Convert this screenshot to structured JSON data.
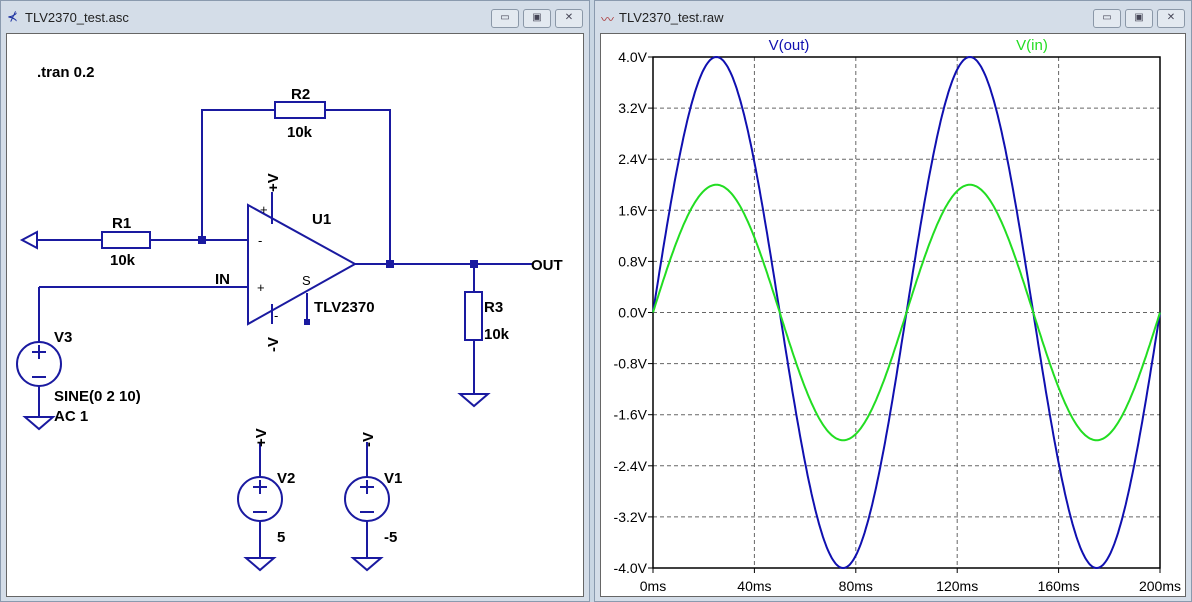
{
  "schematic_window": {
    "title": "TLV2370_test.asc",
    "icon": "schematic-icon",
    "labels": {
      "tran": ".tran 0.2",
      "r1": "R1",
      "r1_val": "10k",
      "r2": "R2",
      "r2_val": "10k",
      "r3": "R3",
      "r3_val": "10k",
      "u1": "U1",
      "u1_model": "TLV2370",
      "in": "IN",
      "out": "OUT",
      "v3": "V3",
      "v3_val1": "SINE(0 2 10)",
      "v3_val2": "AC 1",
      "v2": "V2",
      "v2_val": "5",
      "v1": "V1",
      "v1_val": "-5",
      "plus_v": "+V",
      "minus_v": "-V",
      "shdn": "S"
    }
  },
  "plot_window": {
    "title": "TLV2370_test.raw",
    "icon": "waveform-icon"
  },
  "chart_data": {
    "type": "line",
    "title": "",
    "xlabel": "",
    "ylabel": "",
    "xlim": [
      0,
      200
    ],
    "ylim": [
      -4,
      4
    ],
    "grid": true,
    "x_ticks": [
      "0ms",
      "40ms",
      "80ms",
      "120ms",
      "160ms",
      "200ms"
    ],
    "y_ticks": [
      "4.0V",
      "3.2V",
      "2.4V",
      "1.6V",
      "0.8V",
      "0.0V",
      "-0.8V",
      "-1.6V",
      "-2.4V",
      "-3.2V",
      "-4.0V"
    ],
    "series": [
      {
        "name": "V(out)",
        "color": "#1010b0",
        "function": "4*sin(2*pi*10*t)",
        "amplitude": 4,
        "frequency_hz": 10
      },
      {
        "name": "V(in)",
        "color": "#22dd22",
        "function": "2*sin(2*pi*10*t)",
        "amplitude": 2,
        "frequency_hz": 10
      }
    ]
  }
}
